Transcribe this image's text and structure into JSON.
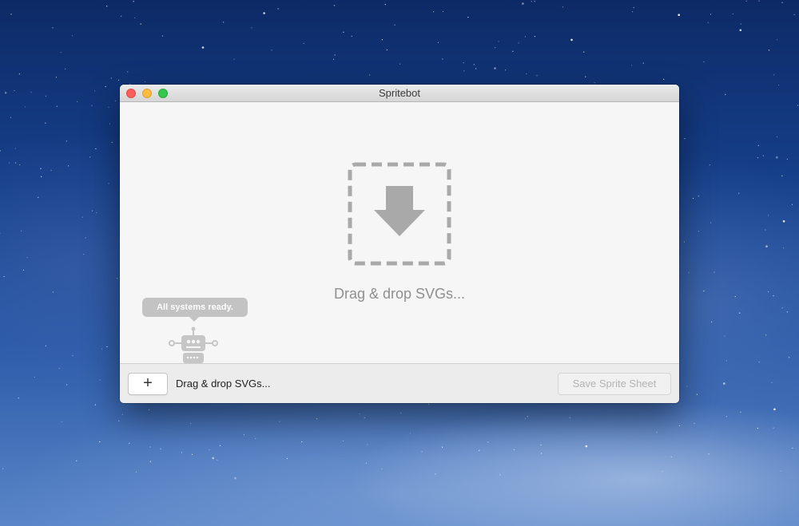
{
  "window": {
    "title": "Spritebot"
  },
  "drop_zone": {
    "icon": "download-arrow-icon",
    "label": "Drag & drop SVGs..."
  },
  "robot": {
    "icon": "robot-icon",
    "status_message": "All systems ready."
  },
  "toolbar": {
    "add_label": "+",
    "status_text": "Drag & drop SVGs...",
    "save_label": "Save Sprite Sheet",
    "save_enabled": false
  },
  "colors": {
    "close": "#fc605c",
    "minimize": "#fdbc40",
    "zoom": "#34c84a",
    "drop_icon": "#a9a9a9",
    "muted_text": "#8f8f8f"
  }
}
